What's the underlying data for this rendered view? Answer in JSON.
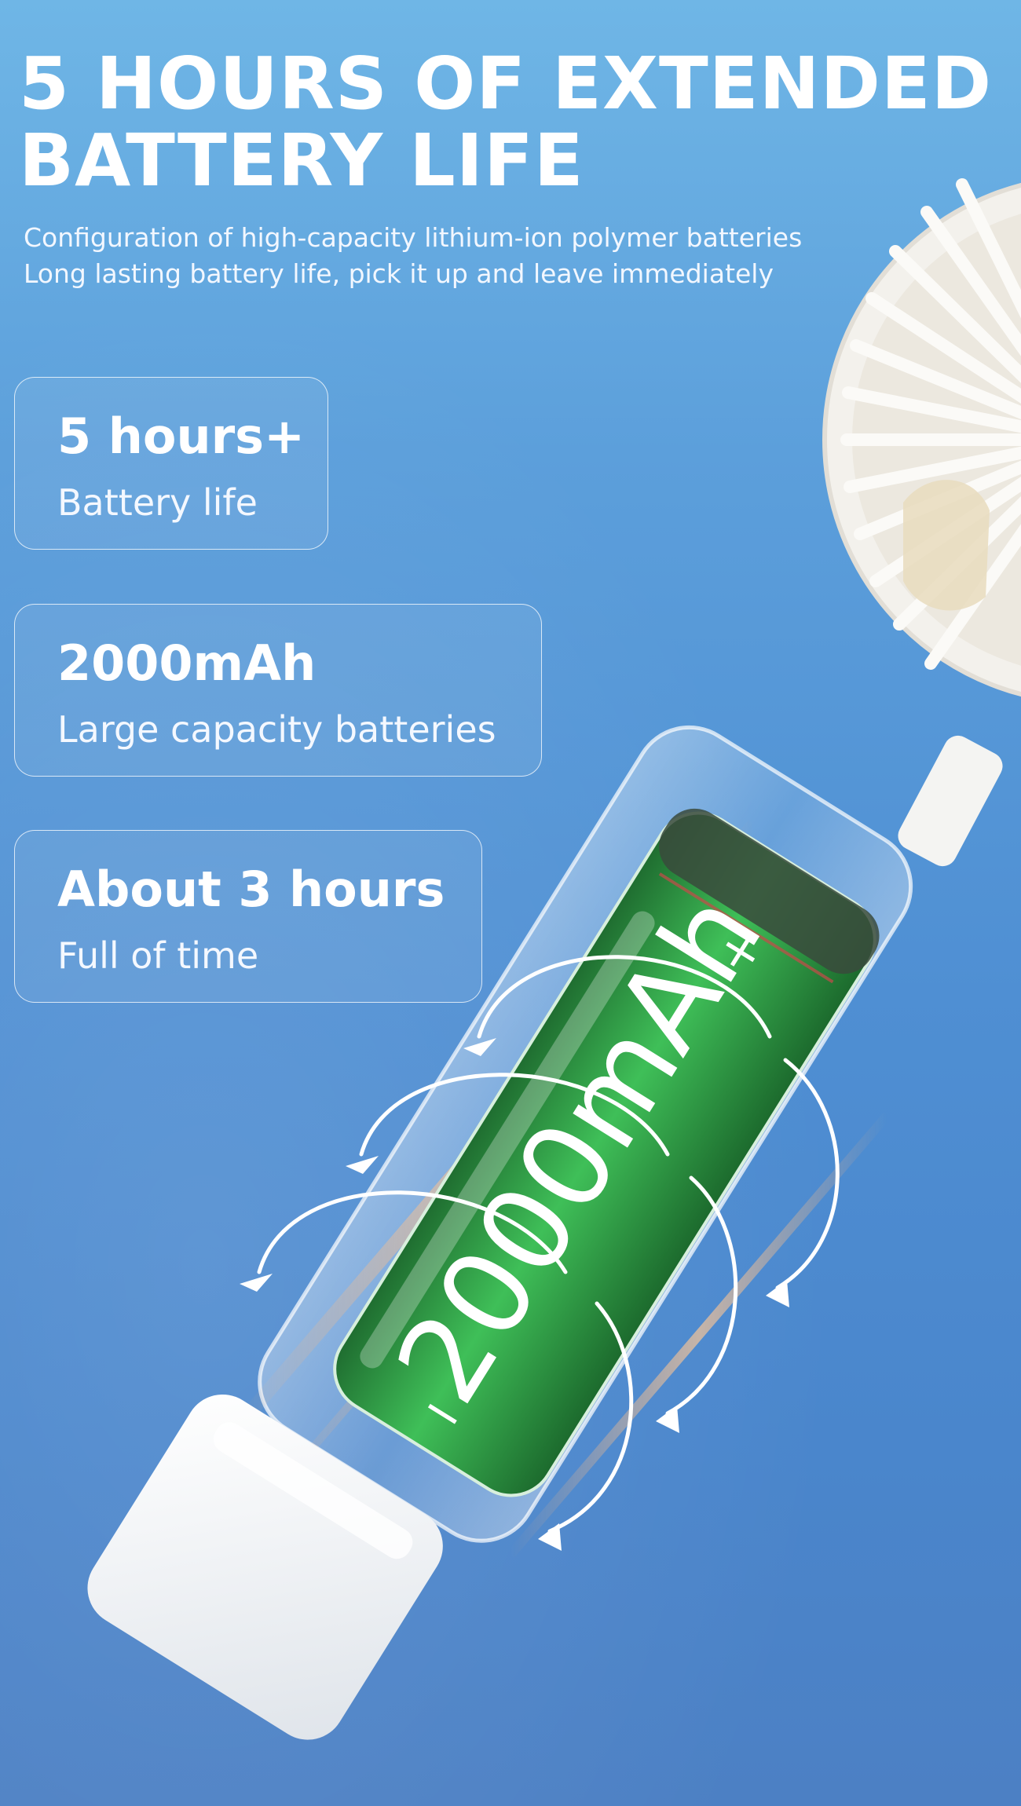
{
  "headline": {
    "line1": "5 HOURS OF EXTENDED",
    "line2": "BATTERY LIFE"
  },
  "subtext": {
    "line1": "Configuration of high-capacity lithium-ion polymer batteries",
    "line2": "Long lasting battery life, pick it up and leave immediately"
  },
  "features": [
    {
      "value": "5 hours+",
      "desc": "Battery life"
    },
    {
      "value": "2000mAh",
      "desc": "Large capacity batteries"
    },
    {
      "value": "About 3 hours",
      "desc": "Full of time"
    }
  ],
  "battery": {
    "label": "2000mAh",
    "plus_symbol": "+",
    "minus_symbol": "−",
    "color": "#2f9a45"
  },
  "icons": [
    "fan-head",
    "battery",
    "rotation-arrows"
  ],
  "colors": {
    "background_top": "#6fb6e6",
    "background_bottom": "#4c80c4",
    "text": "#ffffff",
    "battery_green": "#2f9a45"
  }
}
